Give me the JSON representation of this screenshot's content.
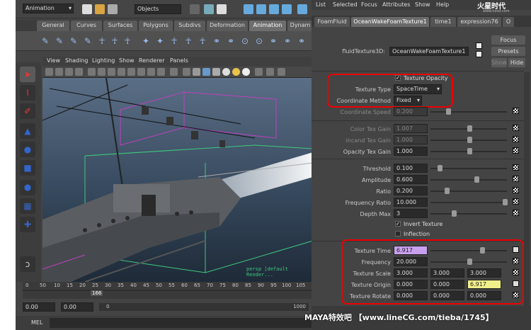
{
  "maya": {
    "mode_dropdown": "Animation",
    "objects_field": "Objects",
    "shelf_tabs": [
      "General",
      "Curves",
      "Surfaces",
      "Polygons",
      "Subdivs",
      "Deformation",
      "Animation",
      "Dynam"
    ],
    "active_shelf": "Animation",
    "viewport_menu": [
      "View",
      "Shading",
      "Lighting",
      "Show",
      "Renderer",
      "Panels"
    ],
    "viewport_overlay": "persp [default Render...",
    "timeline_ticks": [
      "0",
      "50",
      "10",
      "15",
      "20",
      "25",
      "30",
      "35",
      "40",
      "45",
      "50",
      "55",
      "60",
      "65",
      "70",
      "75",
      "80",
      "85",
      "90",
      "95",
      "100",
      "105"
    ],
    "current_frame": "166",
    "range_start": "0.00",
    "range_start2": "0.00",
    "range_inner_start": "0",
    "range_end": "1000",
    "mel_label": "MEL"
  },
  "ae": {
    "menu": [
      "List",
      "Selected",
      "Focus",
      "Attributes",
      "Show",
      "Help"
    ],
    "logo_text": "火星时代",
    "logo_sub": "www.hxsd.com",
    "tabs": [
      "FoamFluid",
      "OceanWakeFoamTexture1",
      "time1",
      "expression76",
      "O"
    ],
    "active_tab": "OceanWakeFoamTexture1",
    "node_label": "fluidTexture3D:",
    "node_name": "OceanWakeFoamTexture1",
    "focus": "Focus",
    "presets": "Presets",
    "show": "Show",
    "hide": "Hide",
    "texture_opacity": "Texture Opacity",
    "texture_type_label": "Texture Type",
    "texture_type": "SpaceTime",
    "coord_method_label": "Coordinate Method",
    "coord_method": "Fixed",
    "coord_speed_label": "Coordinate Speed",
    "coord_speed": "0.200",
    "color_tex_gain_label": "Color Tex Gain",
    "color_tex_gain": "1.007",
    "incand_tex_gain_label": "Incand Tex Gain",
    "incand_tex_gain": "1.000",
    "opacity_tex_gain_label": "Opacity Tex Gain",
    "opacity_tex_gain": "1.000",
    "threshold_label": "Threshold",
    "threshold": "0.100",
    "amplitude_label": "Amplitude",
    "amplitude": "0.600",
    "ratio_label": "Ratio",
    "ratio": "0.200",
    "freq_ratio_label": "Frequency Ratio",
    "freq_ratio": "10.000",
    "depth_max_label": "Depth Max",
    "depth_max": "3",
    "invert_texture": "Invert Texture",
    "inflection": "Inflection",
    "texture_time_label": "Texture Time",
    "texture_time": "6.917",
    "frequency_label": "Frequency",
    "frequency": "20.000",
    "texture_scale_label": "Texture Scale",
    "texture_scale": [
      "3.000",
      "3.000",
      "3.000"
    ],
    "texture_origin_label": "Texture Origin",
    "texture_origin": [
      "0.000",
      "0.000",
      "6.917"
    ],
    "texture_rotate_label": "Texture Rotate",
    "texture_rotate": [
      "0.000",
      "0.000",
      "0.000"
    ]
  },
  "watermark": "MAYA特效吧 【www.lineCG.com/tieba/1745】",
  "colors": {
    "highlight_red": "#e00000",
    "keyed_purple": "#c9a0f0",
    "expr_yellow": "#f0f08a"
  }
}
